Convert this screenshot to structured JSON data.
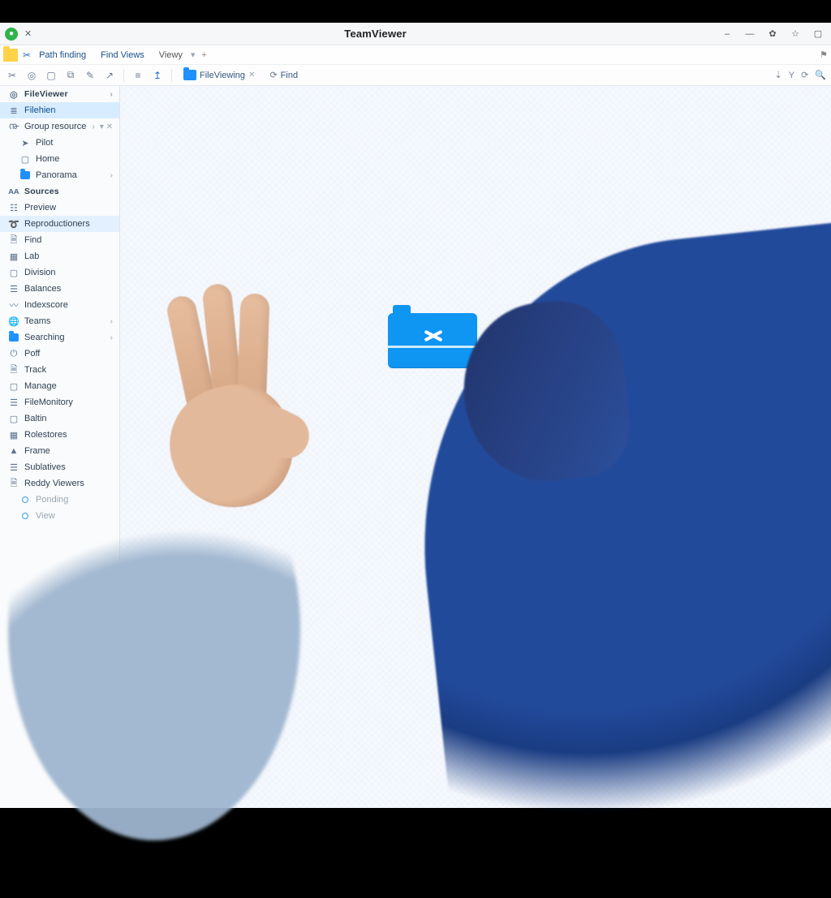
{
  "window": {
    "title": "TeamViewer"
  },
  "menubar": {
    "items": [
      "Path finding",
      "Find Views",
      "Viewy"
    ]
  },
  "toolbar": {
    "tab1": "FileViewing",
    "tab2": "Find"
  },
  "sidebar": {
    "items": [
      {
        "label": "FileViewer",
        "icon": "target",
        "head": true,
        "chev": true
      },
      {
        "label": "Filehien",
        "icon": "list",
        "active": true
      },
      {
        "label": "Group resource",
        "icon": "branch",
        "chev": true,
        "xchev": true
      },
      {
        "label": "Pilot",
        "icon": "cursor",
        "indent": true
      },
      {
        "label": "Home",
        "icon": "square",
        "indent": true
      },
      {
        "label": "Panorama",
        "icon": "folder",
        "indent": true,
        "chev": true
      },
      {
        "label": "Sources",
        "icon": "text",
        "head": true
      },
      {
        "label": "Preview",
        "icon": "bars"
      },
      {
        "label": "Reproductioners",
        "icon": "loop",
        "sel": true
      },
      {
        "label": "Find",
        "icon": "doc"
      },
      {
        "label": "Lab",
        "icon": "grid"
      },
      {
        "label": "Division",
        "icon": "square"
      },
      {
        "label": "Balances",
        "icon": "stack"
      },
      {
        "label": "Indexscore",
        "icon": "wave"
      },
      {
        "label": "Teams",
        "icon": "globe",
        "chev": true
      },
      {
        "label": "Searching",
        "icon": "folder",
        "chev": true
      },
      {
        "label": "Poff",
        "icon": "power"
      },
      {
        "label": "Track",
        "icon": "doc"
      },
      {
        "label": "Manage",
        "icon": "square"
      },
      {
        "label": "FileMonitory",
        "icon": "stack"
      },
      {
        "label": "Baltin",
        "icon": "square"
      },
      {
        "label": "Rolestores",
        "icon": "grid"
      },
      {
        "label": "Frame",
        "icon": "up"
      },
      {
        "label": "Sublatives",
        "icon": "stack"
      },
      {
        "label": "Reddy Viewers",
        "icon": "doc"
      },
      {
        "label": "Ponding",
        "icon": "dot",
        "dimmed": true,
        "indent": true
      },
      {
        "label": "View",
        "icon": "dot",
        "dimmed": true,
        "indent": true
      }
    ]
  }
}
